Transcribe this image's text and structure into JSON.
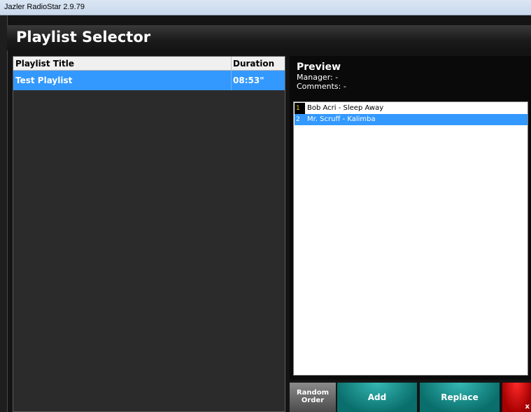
{
  "window": {
    "title": "Jazler RadioStar 2.9.79"
  },
  "header": {
    "title": "Playlist Selector"
  },
  "playlist_table": {
    "columns": [
      "Playlist Title",
      "Duration"
    ],
    "rows": [
      {
        "title": "Test Playlist",
        "duration": "08:53\""
      }
    ]
  },
  "preview": {
    "title": "Preview",
    "manager": "Manager: -",
    "comments": "Comments: -",
    "tracks": [
      {
        "num": "1",
        "name": "Bob Acri - Sleep Away"
      },
      {
        "num": "2",
        "name": "Mr. Scruff - Kalimba"
      }
    ]
  },
  "buttons": {
    "random_order_line1": "Random",
    "random_order_line2": "Order",
    "add": "Add",
    "replace": "Replace",
    "cancel_glyph": "x"
  },
  "colors": {
    "selection": "#3399ff",
    "add_button": "#1a8f8b",
    "cancel_button": "#d00000"
  }
}
